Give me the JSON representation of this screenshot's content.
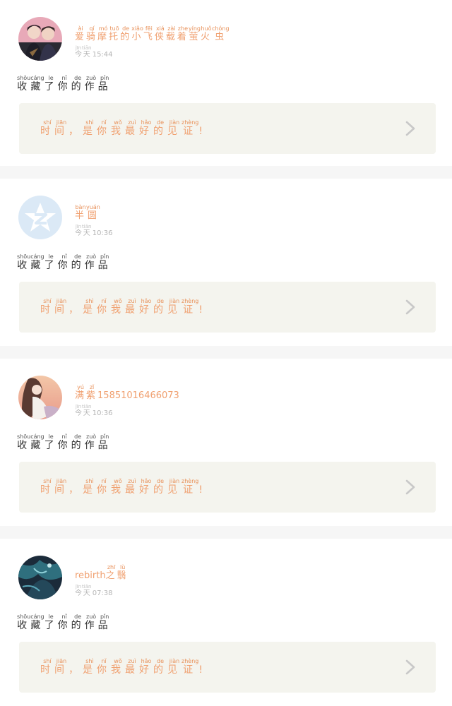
{
  "posts": [
    {
      "user": {
        "name_ruby": [
          [
            "爱",
            "ài"
          ],
          [
            "骑",
            "qí"
          ],
          [
            "摩",
            "mó"
          ],
          [
            "托",
            "tuō"
          ],
          [
            "的",
            "de"
          ],
          [
            "小",
            "xiǎo"
          ],
          [
            "飞",
            "fēi"
          ],
          [
            "侠",
            "xiá"
          ],
          [
            "载",
            "zài"
          ],
          [
            "着",
            "zhe"
          ],
          [
            "萤",
            "yíng"
          ],
          [
            "火",
            "huǒ"
          ],
          [
            "虫",
            "chóng"
          ]
        ],
        "name_suffix": ""
      },
      "time_label": [
        [
          "今",
          "jīn"
        ],
        [
          "天",
          "tiān"
        ]
      ],
      "time": "15:44",
      "avatar": "avatar-couple-photo-icon",
      "action_ruby": [
        [
          "收",
          "shōu"
        ],
        [
          "藏",
          "cáng"
        ],
        [
          "了",
          "le"
        ],
        [
          "你",
          "nǐ"
        ],
        [
          "的",
          "de"
        ],
        [
          "作",
          "zuò"
        ],
        [
          "品",
          "pǐn"
        ]
      ],
      "quote_ruby": [
        [
          "时",
          "shí"
        ],
        [
          "间",
          "jiān"
        ],
        [
          "，",
          ""
        ],
        [
          "是",
          "shì"
        ],
        [
          "你",
          "nǐ"
        ],
        [
          "我",
          "wǒ"
        ],
        [
          "最",
          "zuì"
        ],
        [
          "好",
          "hǎo"
        ],
        [
          "的",
          "de"
        ],
        [
          "见",
          "jiàn"
        ],
        [
          "证",
          "zhèng"
        ],
        [
          "!",
          ""
        ]
      ]
    },
    {
      "user": {
        "name_ruby": [
          [
            "半",
            "bàn"
          ],
          [
            "圆",
            "yuán"
          ]
        ],
        "name_suffix": ""
      },
      "time_label": [
        [
          "今",
          "jīn"
        ],
        [
          "天",
          "tiān"
        ]
      ],
      "time": "10:36",
      "avatar": "default-star-avatar-icon",
      "action_ruby": [
        [
          "收",
          "shōu"
        ],
        [
          "藏",
          "cáng"
        ],
        [
          "了",
          "le"
        ],
        [
          "你",
          "nǐ"
        ],
        [
          "的",
          "de"
        ],
        [
          "作",
          "zuò"
        ],
        [
          "品",
          "pǐn"
        ]
      ],
      "quote_ruby": [
        [
          "时",
          "shí"
        ],
        [
          "间",
          "jiān"
        ],
        [
          "，",
          ""
        ],
        [
          "是",
          "shì"
        ],
        [
          "你",
          "nǐ"
        ],
        [
          "我",
          "wǒ"
        ],
        [
          "最",
          "zuì"
        ],
        [
          "好",
          "hǎo"
        ],
        [
          "的",
          "de"
        ],
        [
          "见",
          "jiàn"
        ],
        [
          "证",
          "zhèng"
        ],
        [
          "!",
          ""
        ]
      ]
    },
    {
      "user": {
        "name_ruby": [
          [
            "满",
            "yú"
          ],
          [
            "紫",
            "zǐ"
          ]
        ],
        "name_suffix": "15851016466073"
      },
      "time_label": [
        [
          "今",
          "jīn"
        ],
        [
          "天",
          "tiān"
        ]
      ],
      "time": "10:36",
      "avatar": "avatar-anime-girl-icon",
      "action_ruby": [
        [
          "收",
          "shōu"
        ],
        [
          "藏",
          "cáng"
        ],
        [
          "了",
          "le"
        ],
        [
          "你",
          "nǐ"
        ],
        [
          "的",
          "de"
        ],
        [
          "作",
          "zuò"
        ],
        [
          "品",
          "pǐn"
        ]
      ],
      "quote_ruby": [
        [
          "时",
          "shí"
        ],
        [
          "间",
          "jiān"
        ],
        [
          "，",
          ""
        ],
        [
          "是",
          "shì"
        ],
        [
          "你",
          "nǐ"
        ],
        [
          "我",
          "wǒ"
        ],
        [
          "最",
          "zuì"
        ],
        [
          "好",
          "hǎo"
        ],
        [
          "的",
          "de"
        ],
        [
          "见",
          "jiàn"
        ],
        [
          "证",
          "zhèng"
        ],
        [
          "!",
          ""
        ]
      ]
    },
    {
      "user": {
        "name_prefix": "rebirth",
        "name_ruby": [
          [
            "之",
            "zhī"
          ],
          [
            "翳",
            "lù"
          ]
        ],
        "name_suffix": ""
      },
      "time_label": [
        [
          "今",
          "jīn"
        ],
        [
          "天",
          "tiān"
        ]
      ],
      "time": "07:38",
      "avatar": "avatar-dark-art-icon",
      "action_ruby": [
        [
          "收",
          "shōu"
        ],
        [
          "藏",
          "cáng"
        ],
        [
          "了",
          "le"
        ],
        [
          "你",
          "nǐ"
        ],
        [
          "的",
          "de"
        ],
        [
          "作",
          "zuò"
        ],
        [
          "品",
          "pǐn"
        ]
      ],
      "quote_ruby": [
        [
          "时",
          "shí"
        ],
        [
          "间",
          "jiān"
        ],
        [
          "，",
          ""
        ],
        [
          "是",
          "shì"
        ],
        [
          "你",
          "nǐ"
        ],
        [
          "我",
          "wǒ"
        ],
        [
          "最",
          "zuì"
        ],
        [
          "好",
          "hǎo"
        ],
        [
          "的",
          "de"
        ],
        [
          "见",
          "jiàn"
        ],
        [
          "证",
          "zhèng"
        ],
        [
          "!",
          ""
        ]
      ]
    }
  ],
  "colors": {
    "accent": "#f0a070",
    "quote_bg": "#f4f4ee",
    "divider": "#f6f6f6",
    "chevron": "#c8c8c8"
  }
}
